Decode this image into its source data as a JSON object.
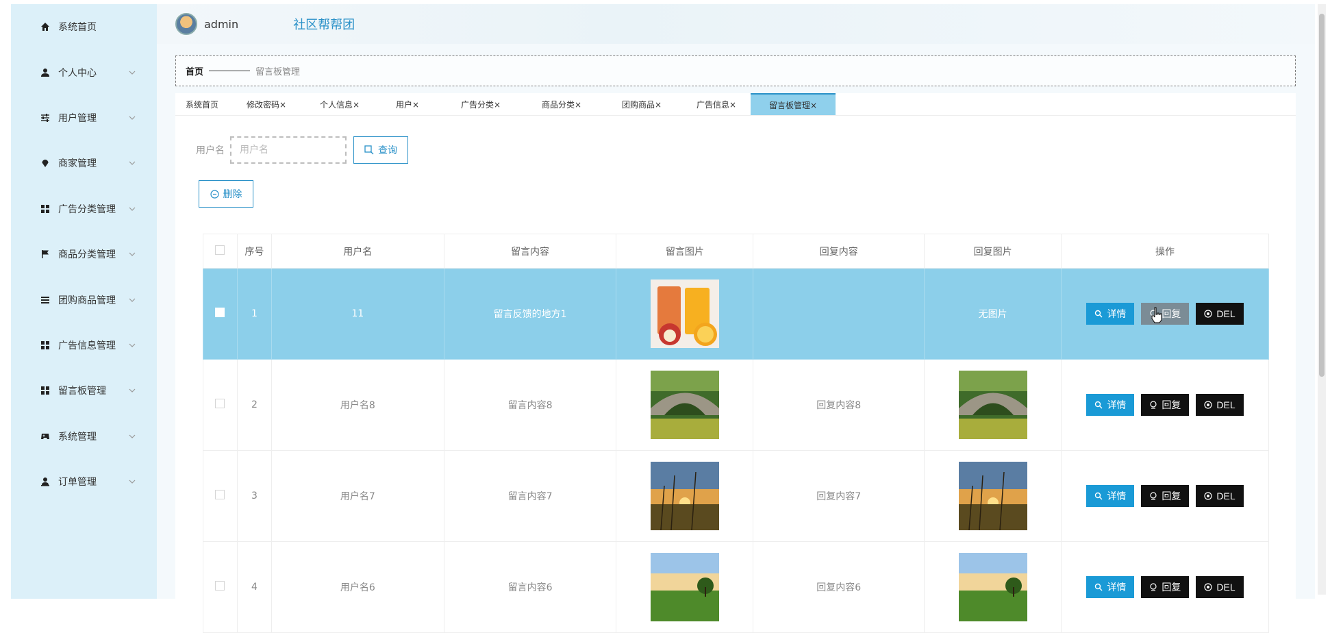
{
  "sidebar": {
    "items": [
      {
        "label": "系统首页",
        "icon": "home-icon",
        "has_chevron": false
      },
      {
        "label": "个人中心",
        "icon": "user-icon",
        "has_chevron": true
      },
      {
        "label": "用户管理",
        "icon": "sliders-icon",
        "has_chevron": true
      },
      {
        "label": "商家管理",
        "icon": "location-pin-icon",
        "has_chevron": true
      },
      {
        "label": "广告分类管理",
        "icon": "grid-icon",
        "has_chevron": true
      },
      {
        "label": "商品分类管理",
        "icon": "flag-icon",
        "has_chevron": true
      },
      {
        "label": "团购商品管理",
        "icon": "list-icon",
        "has_chevron": true
      },
      {
        "label": "广告信息管理",
        "icon": "grid-icon",
        "has_chevron": true
      },
      {
        "label": "留言板管理",
        "icon": "grid-icon",
        "has_chevron": true
      },
      {
        "label": "系统管理",
        "icon": "gamepad-icon",
        "has_chevron": true
      },
      {
        "label": "订单管理",
        "icon": "user-upload-icon",
        "has_chevron": true
      }
    ]
  },
  "header": {
    "username": "admin",
    "brand": "社区帮帮团"
  },
  "breadcrumb": {
    "home": "首页",
    "current": "留言板管理"
  },
  "tabs": [
    {
      "label": "系统首页",
      "active": false
    },
    {
      "label": "修改密码×",
      "active": false
    },
    {
      "label": "个人信息×",
      "active": false
    },
    {
      "label": "用户×",
      "active": false
    },
    {
      "label": "广告分类×",
      "active": false
    },
    {
      "label": "商品分类×",
      "active": false
    },
    {
      "label": "团购商品×",
      "active": false
    },
    {
      "label": "广告信息×",
      "active": false
    },
    {
      "label": "留言板管理×",
      "active": true
    }
  ],
  "search": {
    "label": "用户名",
    "placeholder": "用户名",
    "button": "查询"
  },
  "actions": {
    "delete": "删除"
  },
  "table": {
    "columns": [
      "序号",
      "用户名",
      "留言内容",
      "留言图片",
      "回复内容",
      "回复图片",
      "操作"
    ],
    "rows": [
      {
        "index": "1",
        "username": "11",
        "content": "留言反馈的地方1",
        "image": "juice",
        "reply": "",
        "reply_image": "",
        "reply_image_text": "无图片",
        "selected": true
      },
      {
        "index": "2",
        "username": "用户名8",
        "content": "留言内容8",
        "image": "bridge",
        "reply": "回复内容8",
        "reply_image": "bridge",
        "reply_image_text": "",
        "selected": false
      },
      {
        "index": "3",
        "username": "用户名7",
        "content": "留言内容7",
        "image": "sunset",
        "reply": "回复内容7",
        "reply_image": "sunset",
        "reply_image_text": "",
        "selected": false
      },
      {
        "index": "4",
        "username": "用户名6",
        "content": "留言内容6",
        "image": "field",
        "reply": "回复内容6",
        "reply_image": "field",
        "reply_image_text": "",
        "selected": false
      }
    ],
    "op_labels": {
      "detail": "详情",
      "reply": "回复",
      "del": "DEL"
    }
  },
  "colors": {
    "accent": "#2a91c8",
    "sidebar_bg": "#dcf0f9",
    "selected_row": "#8ccfea",
    "detail_btn": "#1a9ad6"
  }
}
